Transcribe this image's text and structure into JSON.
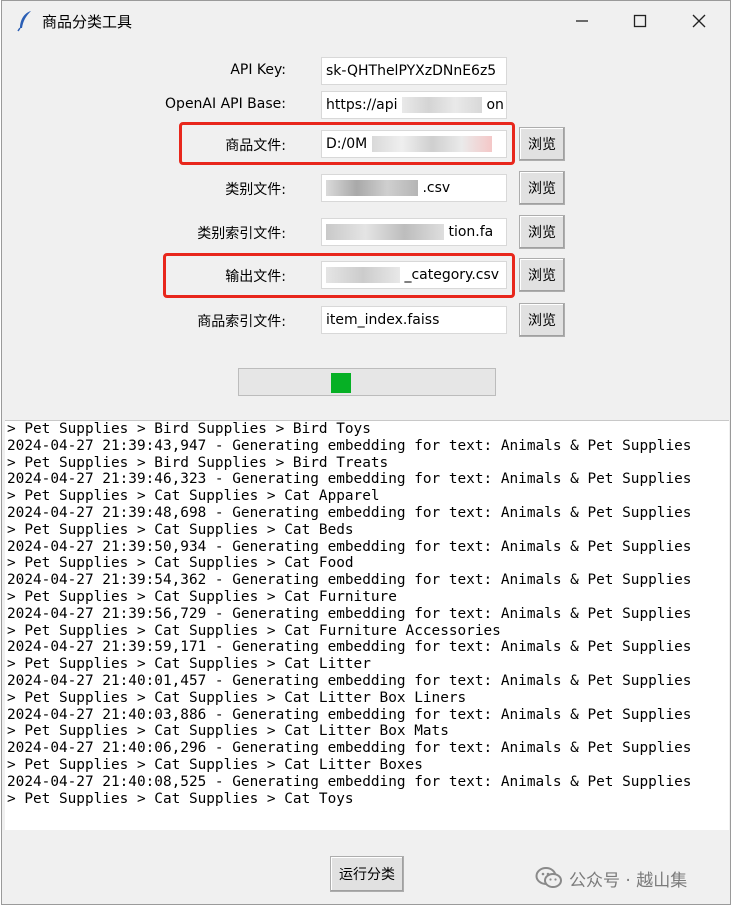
{
  "window": {
    "title": "商品分类工具",
    "controls": {
      "minimize": "minimize",
      "maximize": "maximize",
      "close": "close"
    }
  },
  "form": {
    "rows": [
      {
        "id": "api-key",
        "label": "API Key:",
        "value": "sk-QHThelPYXzDNnE6z5",
        "browse": null
      },
      {
        "id": "api-base",
        "label": "OpenAI API Base:",
        "value": "https://api",
        "value_suffix": "on",
        "browse": null
      },
      {
        "id": "product-file",
        "label": "商品文件:",
        "value": "D:/0M",
        "browse": "浏览"
      },
      {
        "id": "category-file",
        "label": "类别文件:",
        "value": ".csv",
        "browse": "浏览"
      },
      {
        "id": "category-index-file",
        "label": "类别索引文件:",
        "value": "tion.fa",
        "browse": "浏览"
      },
      {
        "id": "output-file",
        "label": "输出文件:",
        "value": "_category.csv",
        "browse": "浏览"
      },
      {
        "id": "product-index-file",
        "label": "商品索引文件:",
        "value": "item_index.faiss",
        "browse": "浏览"
      }
    ]
  },
  "progress": {
    "fraction": 0.39
  },
  "log": [
    "> Pet Supplies > Bird Supplies > Bird Toys",
    "2024-04-27 21:39:43,947 - Generating embedding for text: Animals & Pet Supplies",
    "> Pet Supplies > Bird Supplies > Bird Treats",
    "2024-04-27 21:39:46,323 - Generating embedding for text: Animals & Pet Supplies",
    "> Pet Supplies > Cat Supplies > Cat Apparel",
    "2024-04-27 21:39:48,698 - Generating embedding for text: Animals & Pet Supplies",
    "> Pet Supplies > Cat Supplies > Cat Beds",
    "2024-04-27 21:39:50,934 - Generating embedding for text: Animals & Pet Supplies",
    "> Pet Supplies > Cat Supplies > Cat Food",
    "2024-04-27 21:39:54,362 - Generating embedding for text: Animals & Pet Supplies",
    "> Pet Supplies > Cat Supplies > Cat Furniture",
    "2024-04-27 21:39:56,729 - Generating embedding for text: Animals & Pet Supplies",
    "> Pet Supplies > Cat Supplies > Cat Furniture Accessories",
    "2024-04-27 21:39:59,171 - Generating embedding for text: Animals & Pet Supplies",
    "> Pet Supplies > Cat Supplies > Cat Litter",
    "2024-04-27 21:40:01,457 - Generating embedding for text: Animals & Pet Supplies",
    "> Pet Supplies > Cat Supplies > Cat Litter Box Liners",
    "2024-04-27 21:40:03,886 - Generating embedding for text: Animals & Pet Supplies",
    "> Pet Supplies > Cat Supplies > Cat Litter Box Mats",
    "2024-04-27 21:40:06,296 - Generating embedding for text: Animals & Pet Supplies",
    "> Pet Supplies > Cat Supplies > Cat Litter Boxes",
    "2024-04-27 21:40:08,525 - Generating embedding for text: Animals & Pet Supplies",
    "> Pet Supplies > Cat Supplies > Cat Toys"
  ],
  "run_button": "运行分类",
  "watermark": {
    "text": "公众号 · 越山集",
    "icon": "wechat-icon"
  },
  "colors": {
    "progress_fill": "#06b025",
    "highlight": "#e8271c"
  }
}
